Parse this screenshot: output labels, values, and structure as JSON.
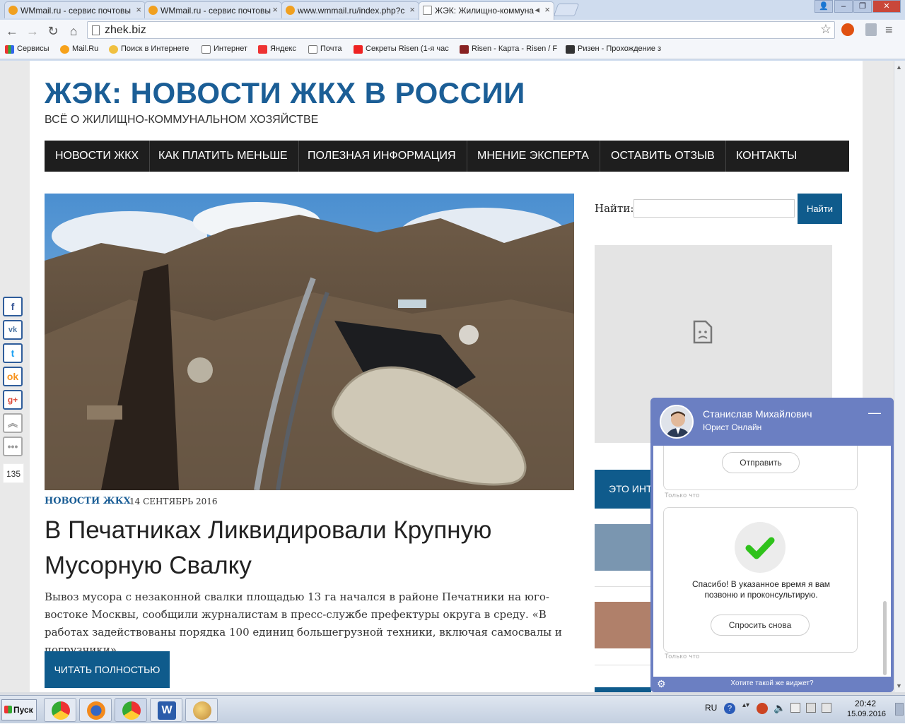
{
  "browser": {
    "tabs": [
      {
        "label": "WMmail.ru - сервис почтовы"
      },
      {
        "label": "WMmail.ru - сервис почтовы"
      },
      {
        "label": "www.wmmail.ru/index.php?c"
      },
      {
        "label": "ЖЭК: Жилищно-коммуна"
      }
    ],
    "url": "zhek.biz",
    "bookmarks": [
      "Сервисы",
      "Mail.Ru",
      "Поиск в Интернете",
      "Интернет",
      "Яндекс",
      "Почта",
      "Секреты Risen (1-я час",
      "Risen - Карта - Risen / F",
      "Ризен - Прохождение з"
    ]
  },
  "site": {
    "title": "ЖЭК: НОВОСТИ ЖКХ В РОССИИ",
    "tagline": "ВСЁ О ЖИЛИЩНО-КОММУНАЛЬНОМ ХОЗЯЙСТВЕ",
    "menu": [
      "НОВОСТИ ЖКХ",
      "КАК ПЛАТИТЬ МЕНЬШЕ",
      "ПОЛЕЗНАЯ ИНФОРМАЦИЯ",
      "МНЕНИЕ ЭКСПЕРТА",
      "ОСТАВИТЬ ОТЗЫВ",
      "КОНТАКТЫ"
    ]
  },
  "article": {
    "category": "НОВОСТИ ЖКХ",
    "date": "14 СЕНТЯБРЬ 2016",
    "headline": "В Печатниках Ликвидировали Крупную Мусорную Свалку",
    "excerpt": "Вывоз мусора с незаконной свалки площадью 13 га начался в районе Печатники на юго-востоке Москвы, сообщили журналистам в пресс-службе префектуры округа в среду. «В работах задействованы порядка 100 единиц большегрузной техники, включая самосвалы и погрузчики»,...",
    "read_more": "ЧИТАТЬ ПОЛНОСТЬЮ"
  },
  "sidebar": {
    "find_label": "Найти:",
    "find_button": "Найти",
    "blue_box": "ЭТО ИНТ"
  },
  "social": {
    "count": "135"
  },
  "chat": {
    "agent_name": "Станислав Михайлович",
    "agent_role": "Юрист Онлайн",
    "send_button": "Отправить",
    "timestamp1": "Только что",
    "thanks_text": "Спасибо! В указанное время я вам позвоню и проконсультирую.",
    "ask_again_button": "Спросить снова",
    "timestamp2": "Только что",
    "footer": "Хотите такой же виджет?"
  },
  "taskbar": {
    "start": "Пуск",
    "lang": "RU",
    "time": "20:42",
    "date": "15.09.2016"
  }
}
